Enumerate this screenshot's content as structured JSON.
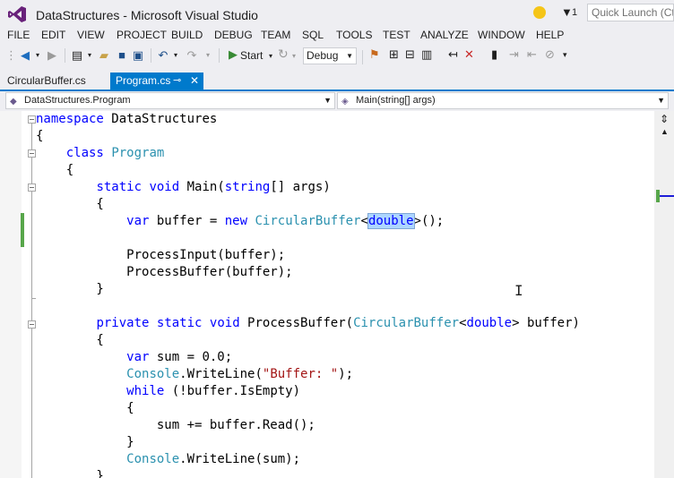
{
  "window": {
    "title": "DataStructures - Microsoft Visual Studio",
    "notification_count": "1",
    "quick_launch_placeholder": "Quick Launch (Ctrl+Q)"
  },
  "menu": [
    "FILE",
    "EDIT",
    "VIEW",
    "PROJECT",
    "BUILD",
    "DEBUG",
    "TEAM",
    "SQL",
    "TOOLS",
    "TEST",
    "ANALYZE",
    "WINDOW",
    "HELP"
  ],
  "toolbar": {
    "start_label": "Start",
    "configuration": "Debug"
  },
  "tabs": [
    {
      "label": "CircularBuffer.cs",
      "active": false
    },
    {
      "label": "Program.cs",
      "active": true
    }
  ],
  "navbar": {
    "type_selector": "DataStructures.Program",
    "member_selector": "Main(string[] args)"
  },
  "code_lines": [
    "namespace DataStructures",
    "{",
    "    class Program",
    "    {",
    "        static void Main(string[] args)",
    "        {",
    "            var buffer = new CircularBuffer<double>();",
    "",
    "            ProcessInput(buffer);",
    "            ProcessBuffer(buffer);",
    "        }",
    "",
    "        private static void ProcessBuffer(CircularBuffer<double> buffer)",
    "        {",
    "            var sum = 0.0;",
    "            Console.WriteLine(\"Buffer: \");",
    "            while (!buffer.IsEmpty)",
    "            {",
    "                sum += buffer.Read();",
    "            }",
    "            Console.WriteLine(sum);",
    "        }"
  ],
  "selection": {
    "line": 7,
    "text": "double"
  },
  "colors": {
    "keyword": "#0000ff",
    "type": "#2b91af",
    "string": "#a31515",
    "accent": "#007acc",
    "change_marker": "#57a64a",
    "selection": "#add6ff"
  }
}
